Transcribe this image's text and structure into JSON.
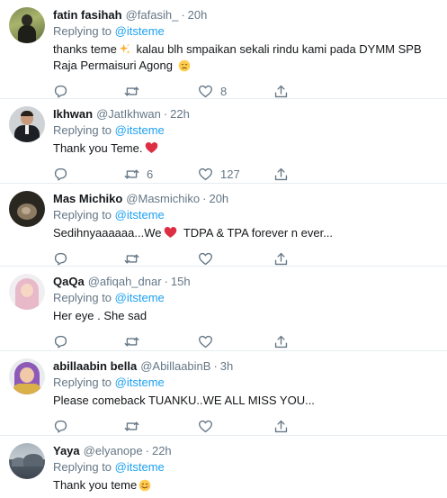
{
  "replying_label": "Replying to",
  "tweets": [
    {
      "name": "fatin fasihah",
      "handle": "@fafasih_",
      "time": "20h",
      "reply_to": "@itsteme",
      "text_a": "thanks teme",
      "emoji_a": "sparkles-emoji",
      "text_b": " kalau blh smpaikan sekali rindu kami pada DYMM SPB Raja Permaisuri Agong ",
      "emoji_b": "disappointed-face-emoji",
      "replies": "",
      "retweets": "",
      "likes": "8"
    },
    {
      "name": "Ikhwan",
      "handle": "@JatIkhwan",
      "time": "22h",
      "reply_to": "@itsteme",
      "text_a": "Thank you Teme.",
      "emoji_a": "red-heart-emoji",
      "replies": "",
      "retweets": "6",
      "likes": "127"
    },
    {
      "name": "Mas Michiko",
      "handle": "@Masmichiko",
      "time": "20h",
      "reply_to": "@itsteme",
      "text_a": "Sedihnyaaaaaa...We",
      "emoji_a": "red-heart-emoji",
      "text_b": " TDPA & TPA forever n ever...",
      "replies": "",
      "retweets": "",
      "likes": ""
    },
    {
      "name": "QaQa",
      "handle": "@afiqah_dnar",
      "time": "15h",
      "reply_to": "@itsteme",
      "text_a": "Her eye . She sad",
      "replies": "",
      "retweets": "",
      "likes": ""
    },
    {
      "name": "abillaabin bella",
      "handle": "@AbillaabinB",
      "time": "3h",
      "reply_to": "@itsteme",
      "text_a": "Please comeback TUANKU..WE ALL MISS YOU...",
      "replies": "",
      "retweets": "",
      "likes": ""
    },
    {
      "name": "Yaya",
      "handle": "@elyanope",
      "time": "22h",
      "reply_to": "@itsteme",
      "text_a": "Thank you teme",
      "emoji_a": "smiling-face-emoji",
      "replies": "",
      "retweets": "",
      "likes": ""
    }
  ],
  "icons": {
    "reply": "reply-icon",
    "retweet": "retweet-icon",
    "like": "heart-icon",
    "share": "share-icon"
  },
  "colors": {
    "link": "#1da1f2",
    "muted": "#657786",
    "text": "#14171a",
    "divider": "#e6ecf0",
    "heart": "#e0245e"
  }
}
